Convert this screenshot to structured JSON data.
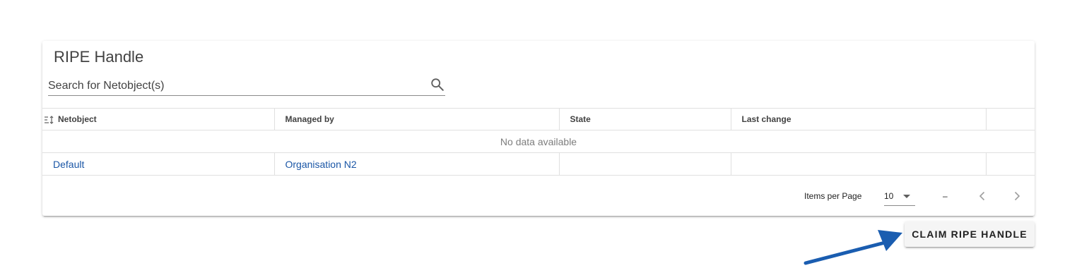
{
  "card": {
    "title": "RIPE Handle",
    "search": {
      "placeholder": "Search for Netobject(s)",
      "value": "",
      "icon": "search-icon"
    }
  },
  "table": {
    "columns": [
      "Netobject",
      "Managed by",
      "State",
      "Last change",
      ""
    ],
    "sort_icon": "sort-icon",
    "no_data_text": "No data available",
    "rows": [
      {
        "netobject": "Default",
        "managed_by": "Organisation N2",
        "state": "",
        "last_change": ""
      }
    ]
  },
  "pagination": {
    "items_per_page_label": "Items per Page",
    "items_per_page_value": "10",
    "range_text": "–",
    "prev_icon": "chevron-left-icon",
    "next_icon": "chevron-right-icon"
  },
  "actions": {
    "claim_label": "CLAIM RIPE HANDLE"
  },
  "annotation": {
    "arrow_icon": "pointer-arrow-icon",
    "arrow_color": "#1a5db0"
  },
  "colors": {
    "link": "#1a56a6",
    "button_bg": "#f5f5f5"
  }
}
